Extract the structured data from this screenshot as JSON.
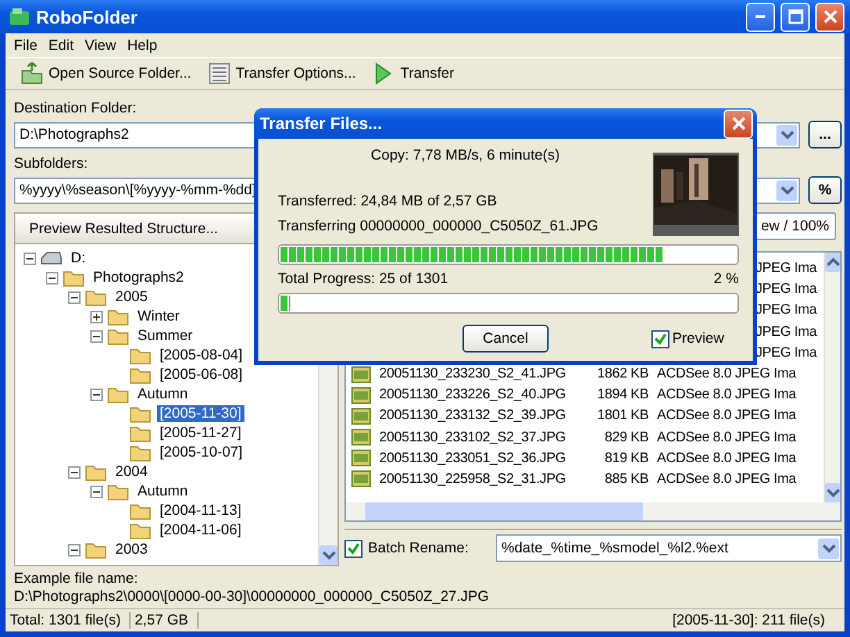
{
  "window": {
    "title": "RoboFolder"
  },
  "menu": [
    {
      "label": "File"
    },
    {
      "label": "Edit"
    },
    {
      "label": "View"
    },
    {
      "label": "Help"
    }
  ],
  "toolbar": [
    {
      "label": "Open Source Folder..."
    },
    {
      "label": "Transfer Options..."
    },
    {
      "label": "Transfer"
    }
  ],
  "destination": {
    "label": "Destination Folder:",
    "value": "D:\\Photographs2",
    "button": "..."
  },
  "subfolders": {
    "label": "Subfolders:",
    "value": "%yyyy\\%season\\[%yyyy-%mm-%dd]",
    "button": "%"
  },
  "preview": {
    "label": "Preview Resulted Structure...",
    "zoom_button": "ew / 100%"
  },
  "tree": [
    {
      "label": "D:",
      "kind": "drive",
      "expanded": true,
      "selected": false,
      "children": [
        {
          "label": "Photographs2",
          "kind": "folder",
          "expanded": true,
          "selected": false,
          "children": [
            {
              "label": "2005",
              "kind": "folder",
              "expanded": true,
              "selected": false,
              "children": [
                {
                  "label": "Winter",
                  "kind": "folder",
                  "expanded": false,
                  "selected": false
                },
                {
                  "label": "Summer",
                  "kind": "folder",
                  "expanded": true,
                  "selected": false,
                  "children": [
                    {
                      "label": "[2005-08-04]",
                      "kind": "folder",
                      "selected": false
                    },
                    {
                      "label": "[2005-06-08]",
                      "kind": "folder",
                      "selected": false
                    }
                  ]
                },
                {
                  "label": "Autumn",
                  "kind": "folder",
                  "expanded": true,
                  "selected": false,
                  "children": [
                    {
                      "label": "[2005-11-30]",
                      "kind": "folder",
                      "selected": true
                    },
                    {
                      "label": "[2005-11-27]",
                      "kind": "folder",
                      "selected": false
                    },
                    {
                      "label": "[2005-10-07]",
                      "kind": "folder",
                      "selected": false
                    }
                  ]
                }
              ]
            },
            {
              "label": "2004",
              "kind": "folder",
              "expanded": true,
              "selected": false,
              "children": [
                {
                  "label": "Autumn",
                  "kind": "folder",
                  "expanded": true,
                  "selected": false,
                  "children": [
                    {
                      "label": "[2004-11-13]",
                      "kind": "folder",
                      "selected": false
                    },
                    {
                      "label": "[2004-11-06]",
                      "kind": "folder",
                      "selected": false
                    }
                  ]
                }
              ]
            },
            {
              "label": "2003",
              "kind": "folder",
              "expanded": true,
              "selected": false
            }
          ]
        }
      ]
    }
  ],
  "files": {
    "rows": [
      {
        "type": "JPEG Ima"
      },
      {
        "type": "JPEG Ima"
      },
      {
        "type": "JPEG Ima"
      },
      {
        "type": "JPEG Ima"
      },
      {
        "type": "JPEG Ima"
      },
      {
        "name": "20051130_233230_S2_41.JPG",
        "size": "1862 KB",
        "type": "ACDSee 8.0 JPEG Ima"
      },
      {
        "name": "20051130_233226_S2_40.JPG",
        "size": "1894 KB",
        "type": "ACDSee 8.0 JPEG Ima"
      },
      {
        "name": "20051130_233132_S2_39.JPG",
        "size": "1801 KB",
        "type": "ACDSee 8.0 JPEG Ima"
      },
      {
        "name": "20051130_233102_S2_37.JPG",
        "size": "829 KB",
        "type": "ACDSee 8.0 JPEG Ima"
      },
      {
        "name": "20051130_233051_S2_36.JPG",
        "size": "819 KB",
        "type": "ACDSee 8.0 JPEG Ima"
      },
      {
        "name": "20051130_225958_S2_31.JPG",
        "size": "885 KB",
        "type": "ACDSee 8.0 JPEG Ima"
      }
    ]
  },
  "batch_rename": {
    "label": "Batch Rename:",
    "checked": true,
    "value": "%date_%time_%smodel_%l2.%ext"
  },
  "example": {
    "label": "Example file name:",
    "value": "D:\\Photographs2\\0000\\[0000-00-30]\\00000000_000000_C5050Z_27.JPG"
  },
  "status_bar": [
    "Total: 1301 file(s)",
    "2,57 GB",
    "[2005-11-30]: 211 file(s)"
  ],
  "dialog": {
    "title": "Transfer Files...",
    "speed": "Copy: 7,78 MB/s, 6 minute(s)",
    "transferred": "Transferred: 24,84 MB of 2,57 GB",
    "current": "Transferring 00000000_000000_C5050Z_61.JPG",
    "file_progress": {
      "level": 0.84
    },
    "total_label": "Total Progress: 25 of 1301",
    "total_percent": "2 %",
    "total_progress": {
      "level": 0.02
    },
    "cancel": "Cancel",
    "preview": {
      "label": "Preview",
      "checked": true
    }
  }
}
